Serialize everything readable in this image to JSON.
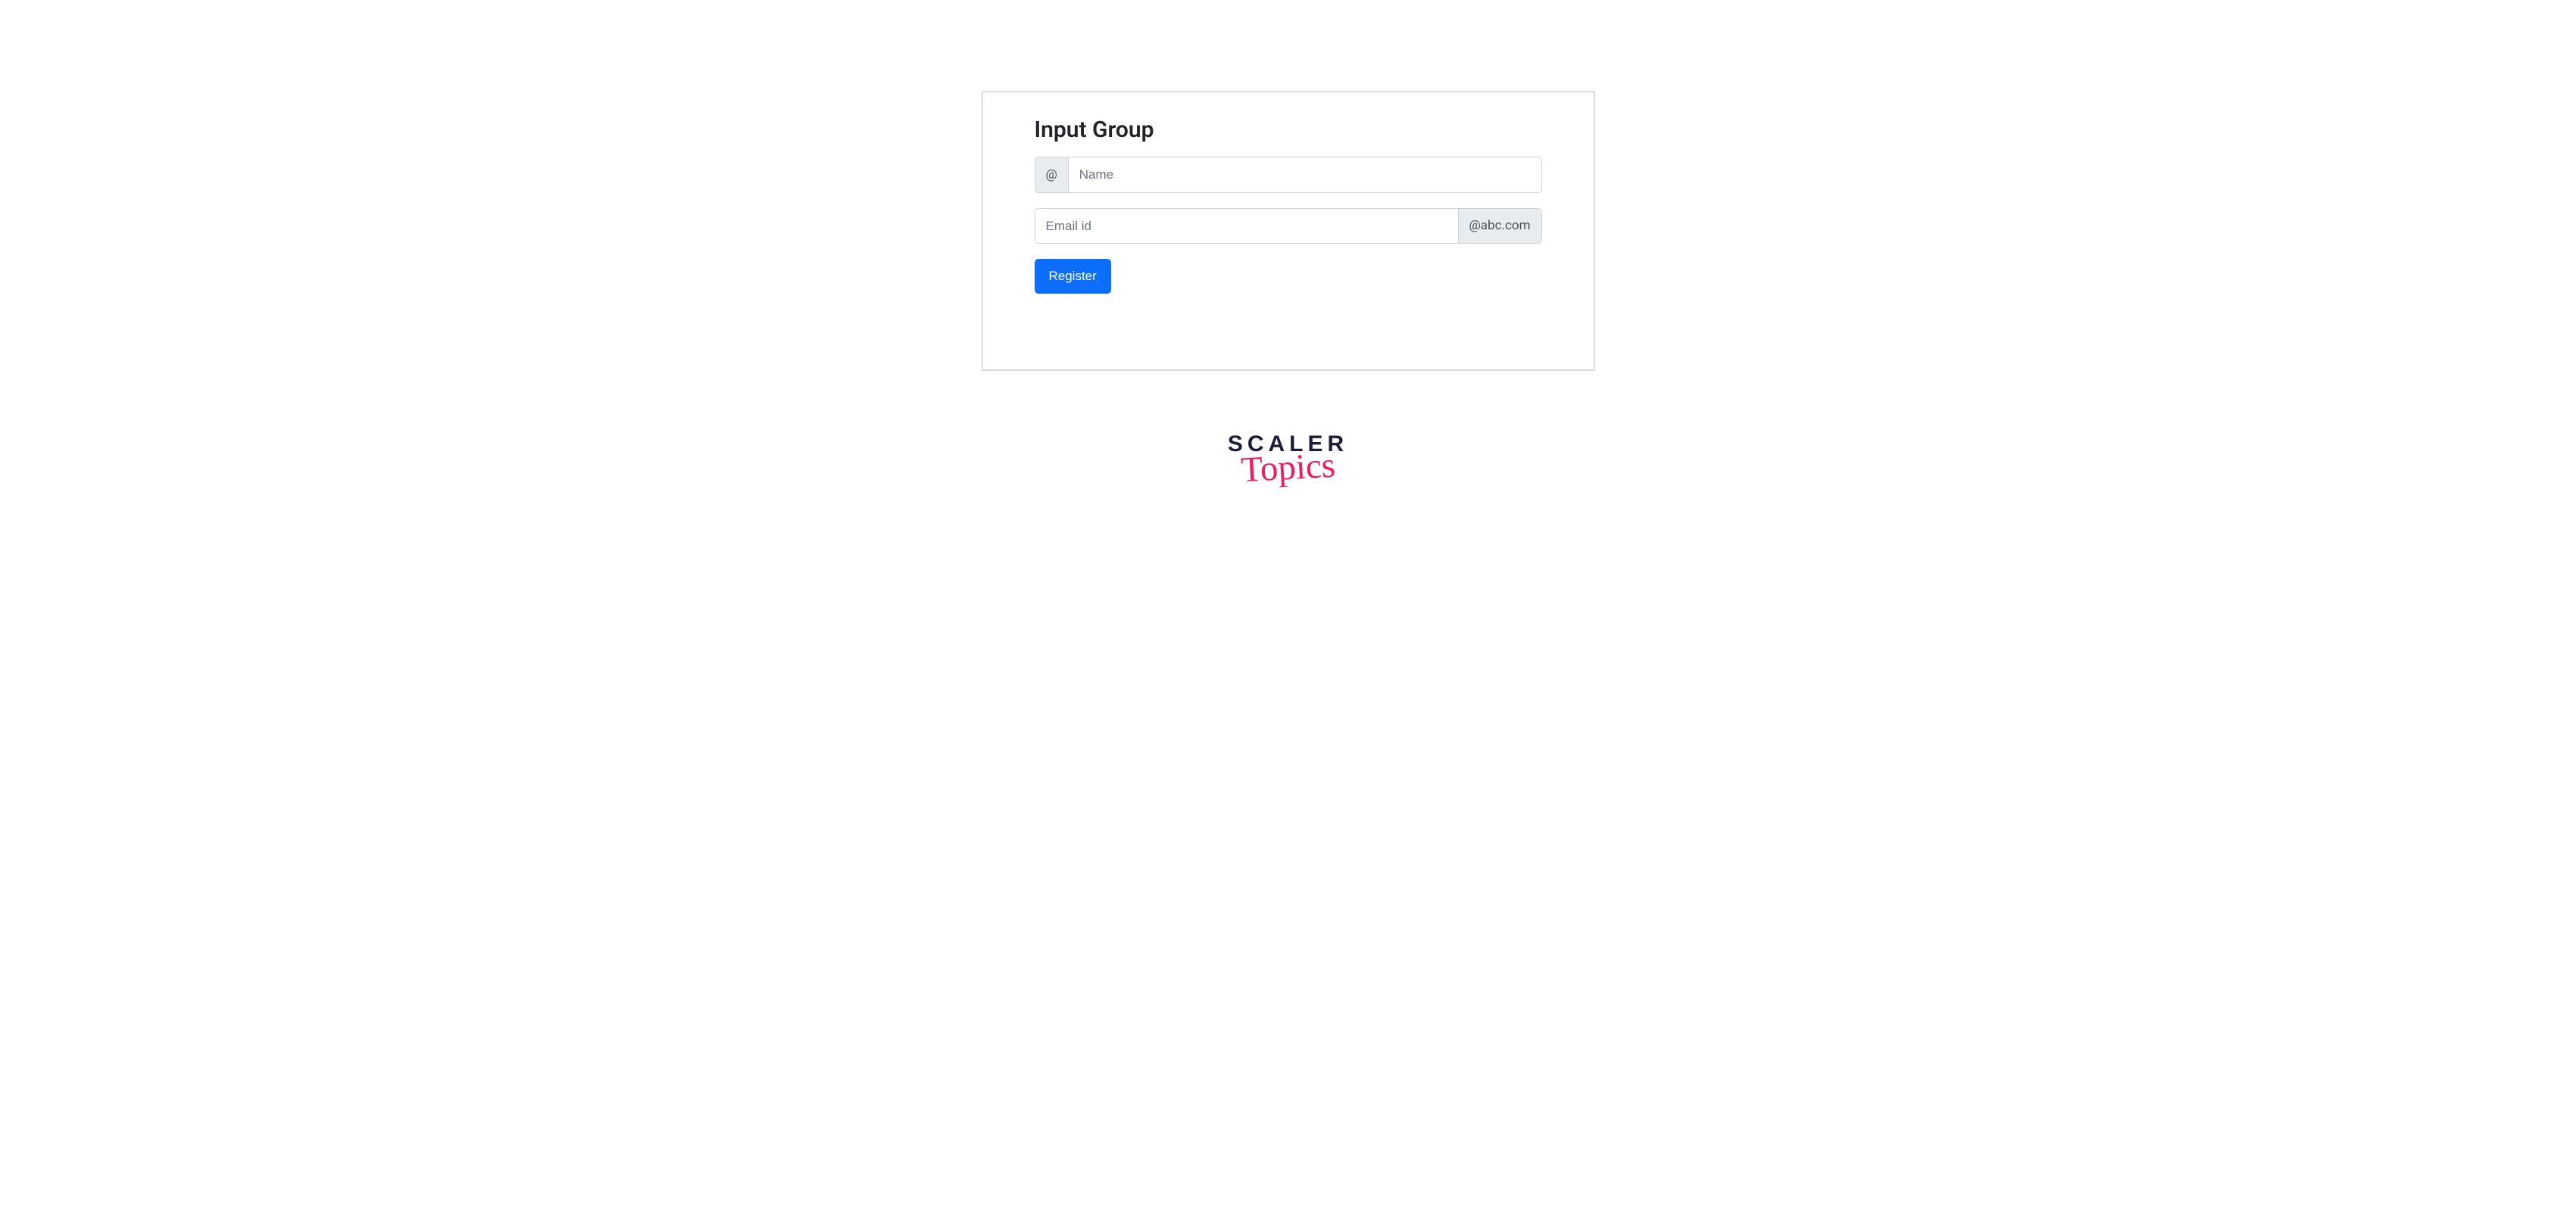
{
  "card": {
    "title": "Input Group"
  },
  "form": {
    "name_prefix": "@",
    "name_placeholder": "Name",
    "email_placeholder": "Email id",
    "email_suffix": "@abc.com",
    "submit_label": "Register"
  },
  "logo": {
    "line1": "SCALER",
    "line2": "Topics"
  }
}
